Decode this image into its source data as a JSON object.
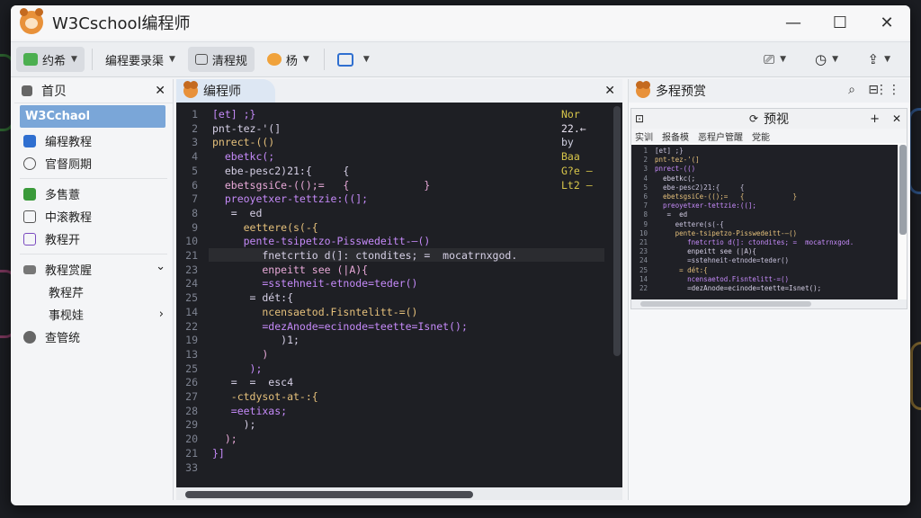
{
  "window": {
    "title": "W3Cschool编程师",
    "minimize": "—",
    "maximize": "☐",
    "close": "✕"
  },
  "toolbar": {
    "btn1": "约希",
    "btn2": "编程要录渠",
    "btn3": "清程规",
    "btn4": "杨"
  },
  "sidebar": {
    "header": "首贝",
    "close": "✕",
    "items": [
      {
        "label": "W3Cchaol"
      },
      {
        "label": "编程教程"
      },
      {
        "label": "官督厕期"
      },
      {
        "label": "多售薏"
      },
      {
        "label": "中滚教程"
      },
      {
        "label": "教程开"
      },
      {
        "label": "教程赏腥"
      },
      {
        "label": "教程芹"
      },
      {
        "label": "事枧娃"
      },
      {
        "label": "查管统"
      }
    ],
    "expand_caret": "⌄",
    "sub_caret": "›"
  },
  "editor": {
    "tab": "编程师",
    "close": "✕",
    "lines": [
      {
        "n": "1",
        "code": "[et] ;}"
      },
      {
        "n": "2",
        "code": "pnt-tez-'(]"
      },
      {
        "n": "3",
        "code": "pnrect-(()"
      },
      {
        "n": "4",
        "code": "  ebetkc(;"
      },
      {
        "n": "5",
        "code": "  ebe-pesc2)21:{     {"
      },
      {
        "n": "6",
        "code": "  ebetsgsiCe-(();=   {            }"
      },
      {
        "n": "7",
        "code": "  preoyetxer-tettzie:((];"
      },
      {
        "n": "8",
        "code": "   =  ed"
      },
      {
        "n": "9",
        "code": "     eettere(s(-{"
      },
      {
        "n": "10",
        "code": "     pente-tsipetzo-Pisswedeitt-—()"
      },
      {
        "n": "21",
        "code": "        fnetcrt​io d(]: ctondites; =  mocatrnxgod."
      },
      {
        "n": "23",
        "code": "        enpeitt see (|A){"
      },
      {
        "n": "24",
        "code": "        =sstehneit-etnode=teder()"
      },
      {
        "n": "25",
        "code": "      = dét:{"
      },
      {
        "n": "14",
        "code": "        ncensaetod.Fisntelitt-=()"
      },
      {
        "n": "22",
        "code": "        =dezAnode=ecinode=teette=Isnet();"
      },
      {
        "n": "19",
        "code": "           )1;"
      },
      {
        "n": "13",
        "code": "        )"
      },
      {
        "n": "25",
        "code": "      );"
      },
      {
        "n": "26",
        "code": "   =  =  esc4"
      },
      {
        "n": "27",
        "code": "   -ctdysot-at-:{"
      },
      {
        "n": "28",
        "code": "   =eetixas;"
      },
      {
        "n": "29",
        "code": "     );"
      },
      {
        "n": "20",
        "code": "  );"
      },
      {
        "n": "21",
        "code": "}]"
      },
      {
        "n": "33",
        "code": ""
      }
    ],
    "right_notes": [
      {
        "text": "Nor",
        "color": "#d8c64a"
      },
      {
        "text": "22.←",
        "color": "#e8e2f0"
      },
      {
        "text": "by",
        "color": "#cfcfe0"
      },
      {
        "text": "Baa",
        "color": "#d8c64a"
      },
      {
        "text": "G?e —",
        "color": "#d8c64a"
      },
      {
        "text": "Lt2 —",
        "color": "#d8c64a"
      }
    ]
  },
  "preview": {
    "tab": "多程预赏",
    "inner_title": "预视",
    "menu": [
      "实训",
      "报备模",
      "恶程户管醒",
      "党能"
    ]
  },
  "colors": {
    "accent": "#7aa6d8",
    "keyword": "#c58af9",
    "string": "#e5c07b",
    "code_bg": "#1e1f24"
  }
}
